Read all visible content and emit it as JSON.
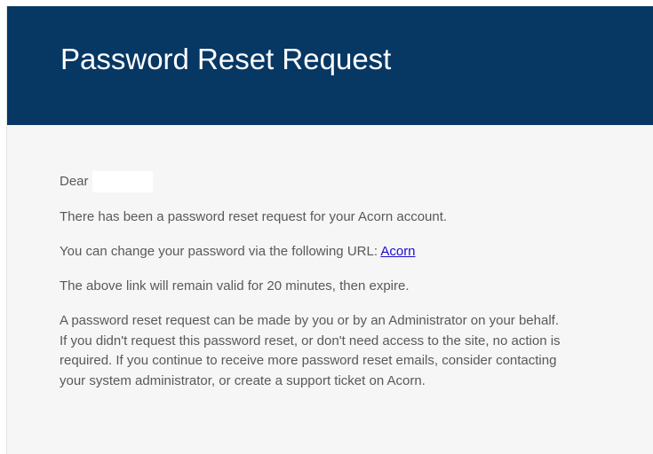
{
  "email": {
    "banner_title": "Password Reset Request",
    "greeting": "Dear",
    "line_request": "There has been a password reset request for your Acorn account.",
    "line_url_prefix": "You can change your password via the following URL:",
    "url_link_label": "Acorn",
    "line_validity": "The above link will remain valid for 20 minutes, then expire.",
    "paragraph_lines": [
      "A password reset request can be made by you or by an Administrator on your behalf.",
      "If you didn't request this password reset, or don't need access to the site, no action is",
      "required. If you continue to receive more password reset emails, consider contacting",
      "your system administrator, or create a support ticket on Acorn."
    ]
  },
  "colors": {
    "banner": "#073763",
    "body_background": "#f6f6f6",
    "text": "#595959",
    "link": "#1a0dcc"
  }
}
